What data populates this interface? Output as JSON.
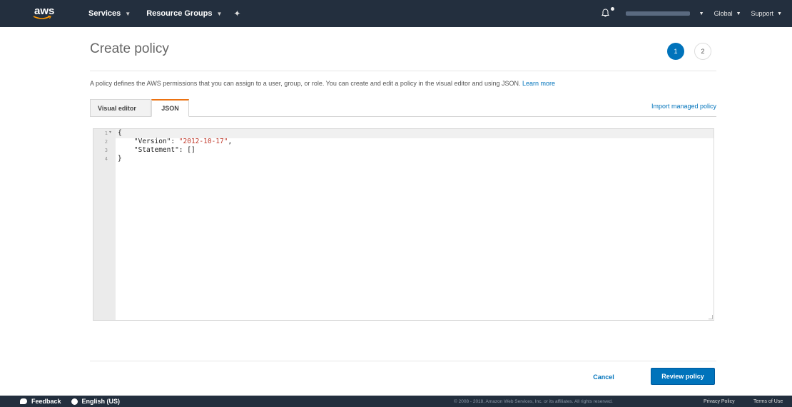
{
  "topnav": {
    "logo_text": "aws",
    "services_label": "Services",
    "resource_groups_label": "Resource Groups",
    "region_label": "Global",
    "support_label": "Support"
  },
  "page": {
    "title": "Create policy",
    "steps": [
      "1",
      "2"
    ],
    "description": "A policy defines the AWS permissions that you can assign to a user, group, or role. You can create and edit a policy in the visual editor and using JSON.",
    "learn_more": "Learn more",
    "tabs": [
      {
        "label": "Visual editor",
        "active": false
      },
      {
        "label": "JSON",
        "active": true
      }
    ],
    "import_link": "Import managed policy"
  },
  "editor": {
    "line_numbers": [
      "1",
      "2",
      "3",
      "4"
    ],
    "lines": {
      "l1": "{",
      "l2_key": "    \"Version\": ",
      "l2_val": "\"2012-10-17\"",
      "l2_end": ",",
      "l3": "    \"Statement\": []",
      "l4": "}"
    }
  },
  "actions": {
    "cancel_label": "Cancel",
    "review_label": "Review policy"
  },
  "footer": {
    "feedback_label": "Feedback",
    "language_label": "English (US)",
    "copyright": "© 2008 - 2018, Amazon Web Services, Inc. or its affiliates. All rights reserved.",
    "privacy_label": "Privacy Policy",
    "terms_label": "Terms of Use"
  },
  "colors": {
    "nav_bg": "#232f3e",
    "primary": "#0073bb",
    "tab_accent": "#ec7211",
    "json_string": "#c0392b"
  }
}
